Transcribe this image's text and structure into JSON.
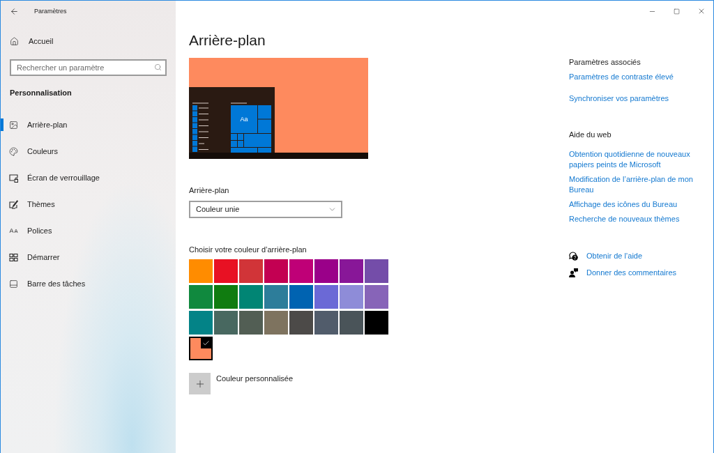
{
  "window": {
    "title": "Paramètres"
  },
  "sidebar": {
    "home": "Accueil",
    "search": {
      "placeholder": "Rechercher un paramètre"
    },
    "section": "Personnalisation",
    "items": [
      {
        "label": "Arrière-plan",
        "selected": true
      },
      {
        "label": "Couleurs",
        "selected": false
      },
      {
        "label": "Écran de verrouillage",
        "selected": false
      },
      {
        "label": "Thèmes",
        "selected": false
      },
      {
        "label": "Polices",
        "selected": false
      },
      {
        "label": "Démarrer",
        "selected": false
      },
      {
        "label": "Barre des tâches",
        "selected": false
      }
    ]
  },
  "page": {
    "title": "Arrière-plan",
    "preview": {
      "tile_text": "Aa"
    },
    "background": {
      "label": "Arrière-plan",
      "value": "Couleur unie"
    },
    "colors": {
      "label": "Choisir votre couleur d’arrière-plan",
      "swatches": [
        {
          "color": "#ff8c00",
          "selected": false
        },
        {
          "color": "#e81123",
          "selected": false
        },
        {
          "color": "#d13438",
          "selected": false
        },
        {
          "color": "#c30052",
          "selected": false
        },
        {
          "color": "#bf0077",
          "selected": false
        },
        {
          "color": "#9a0089",
          "selected": false
        },
        {
          "color": "#881798",
          "selected": false
        },
        {
          "color": "#744da9",
          "selected": false
        },
        {
          "color": "#10893e",
          "selected": false
        },
        {
          "color": "#107c10",
          "selected": false
        },
        {
          "color": "#018574",
          "selected": false
        },
        {
          "color": "#2d7d9a",
          "selected": false
        },
        {
          "color": "#0063b1",
          "selected": false
        },
        {
          "color": "#6b69d6",
          "selected": false
        },
        {
          "color": "#8e8cd8",
          "selected": false
        },
        {
          "color": "#8764b8",
          "selected": false
        },
        {
          "color": "#038387",
          "selected": false
        },
        {
          "color": "#486860",
          "selected": false
        },
        {
          "color": "#525e54",
          "selected": false
        },
        {
          "color": "#7e735f",
          "selected": false
        },
        {
          "color": "#4c4a48",
          "selected": false
        },
        {
          "color": "#515c6b",
          "selected": false
        },
        {
          "color": "#4a5459",
          "selected": false
        },
        {
          "color": "#000000",
          "selected": false
        },
        {
          "color": "#fe8a5e",
          "selected": true
        }
      ],
      "custom": "Couleur personnalisée"
    }
  },
  "related": {
    "title": "Paramètres associés",
    "links": [
      "Paramètres de contraste élevé",
      "Synchroniser vos paramètres"
    ]
  },
  "web_help": {
    "title": "Aide du web",
    "links": [
      "Obtention quotidienne de nouveaux papiers peints de Microsoft",
      "Modification de l’arrière-plan de mon Bureau",
      "Affichage des icônes du Bureau",
      "Recherche de nouveaux thèmes"
    ]
  },
  "support": [
    "Obtenir de l’aide",
    "Donner des commentaires"
  ]
}
